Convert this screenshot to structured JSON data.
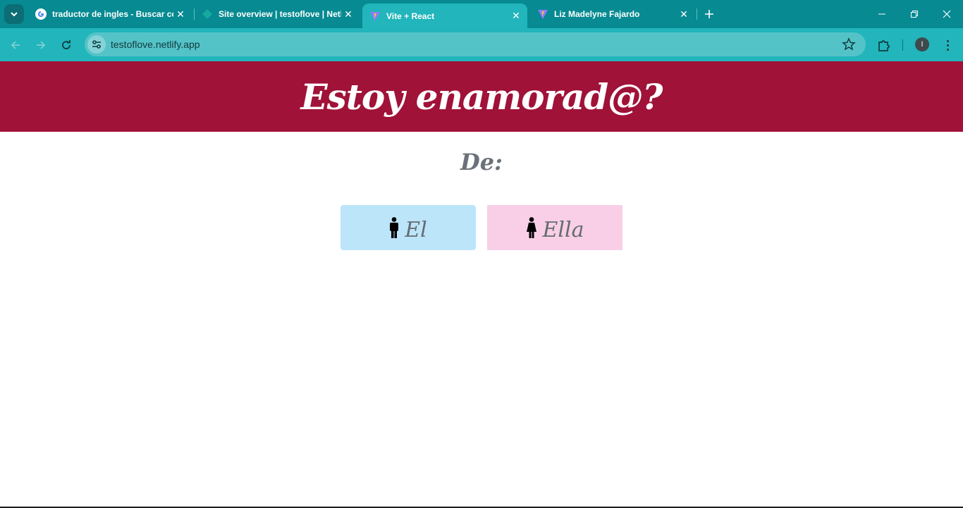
{
  "browser": {
    "tabs": [
      {
        "title": "traductor de ingles - Buscar con Google",
        "favicon": "google-icon",
        "active": false
      },
      {
        "title": "Site overview | testoflove | Netlify",
        "favicon": "netlify-icon",
        "active": false
      },
      {
        "title": "Vite + React",
        "favicon": "vite-icon",
        "active": true
      },
      {
        "title": "Liz Madelyne Fajardo",
        "favicon": "vite-icon",
        "active": false
      }
    ],
    "url": "testoflove.netlify.app",
    "profile_initial": "I"
  },
  "page": {
    "title": "Estoy enamorad@?",
    "from_label": "De:",
    "options": [
      {
        "label": "El",
        "icon": "male-icon",
        "color": "#bce5fa"
      },
      {
        "label": "Ella",
        "icon": "female-icon",
        "color": "#f8cfe7"
      }
    ]
  },
  "colors": {
    "chrome_tabbar": "#078a92",
    "chrome_toolbar": "#22b5bc",
    "hero": "#a01238"
  }
}
